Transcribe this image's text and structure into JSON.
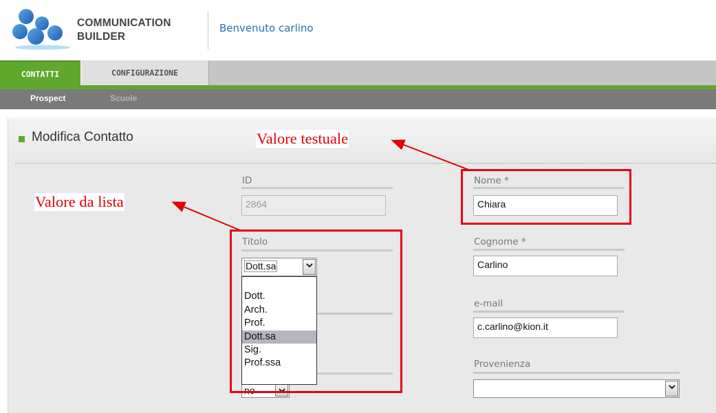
{
  "header": {
    "brand_line1": "COMMUNICATION",
    "brand_line2": "BUILDER",
    "welcome": "Benvenuto carlino"
  },
  "nav": {
    "tabs": [
      {
        "label": "CONTATTI",
        "active": true
      },
      {
        "label": "CONFIGURAZIONE",
        "active": false
      }
    ],
    "subnav": [
      {
        "label": "Prospect",
        "active": true
      },
      {
        "label": "Scuole",
        "active": false
      }
    ]
  },
  "section": {
    "title": "Modifica Contatto"
  },
  "form": {
    "id": {
      "label": "ID",
      "value": "2864"
    },
    "titolo": {
      "label": "Titolo",
      "value": "Dott.sa",
      "options": [
        "",
        "Dott.",
        "Arch.",
        "Prof.",
        "Dott.sa",
        "Sig.",
        "Prof.ssa"
      ],
      "selected_index": 4
    },
    "hidden_select_value": "no",
    "nome": {
      "label": "Nome *",
      "value": "Chiara"
    },
    "cognome": {
      "label": "Cognome *",
      "value": "Carlino"
    },
    "email": {
      "label": "e-mail",
      "value": "c.carlino@kion.it"
    },
    "provenienza": {
      "label": "Provenienza",
      "value": ""
    }
  },
  "annotations": {
    "text_value": "Valore testuale",
    "list_value": "Valore da lista",
    "color": "#e00000"
  },
  "colors": {
    "accent_green": "#5fa82d",
    "link_blue": "#2a6fb0",
    "subnav_gray": "#7a7a7a"
  },
  "icons": [
    "logo-icon",
    "chevron-down-icon"
  ]
}
